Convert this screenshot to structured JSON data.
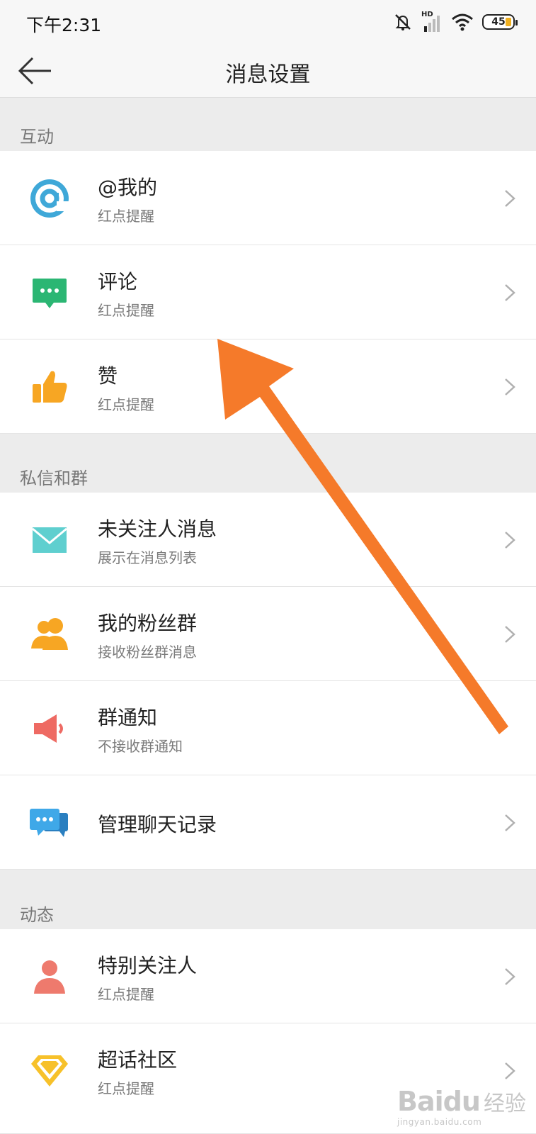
{
  "status_bar": {
    "time": "下午2:31",
    "battery_level": "45",
    "network_label": "HD"
  },
  "nav": {
    "title": "消息设置"
  },
  "sections": [
    {
      "header": "互动",
      "items": [
        {
          "title": "@我的",
          "subtitle": "红点提醒",
          "icon": "at-sign-icon",
          "has_chevron": true
        },
        {
          "title": "评论",
          "subtitle": "红点提醒",
          "icon": "comment-icon",
          "has_chevron": true
        },
        {
          "title": "赞",
          "subtitle": "红点提醒",
          "icon": "thumbs-up-icon",
          "has_chevron": true
        }
      ]
    },
    {
      "header": "私信和群",
      "items": [
        {
          "title": "未关注人消息",
          "subtitle": "展示在消息列表",
          "icon": "envelope-icon",
          "has_chevron": true
        },
        {
          "title": "我的粉丝群",
          "subtitle": "接收粉丝群消息",
          "icon": "fans-group-icon",
          "has_chevron": true
        },
        {
          "title": "群通知",
          "subtitle": "不接收群通知",
          "icon": "megaphone-icon",
          "has_chevron": true
        },
        {
          "title": "管理聊天记录",
          "subtitle": "",
          "icon": "chat-bubbles-icon",
          "has_chevron": true
        }
      ]
    },
    {
      "header": "动态",
      "items": [
        {
          "title": "特别关注人",
          "subtitle": "红点提醒",
          "icon": "person-icon",
          "has_chevron": true
        },
        {
          "title": "超话社区",
          "subtitle": "红点提醒",
          "icon": "diamond-icon",
          "has_chevron": true
        }
      ]
    }
  ],
  "watermark": {
    "logo": "Baidu",
    "cn": "经验",
    "url": "jingyan.baidu.com"
  },
  "colors": {
    "annotation_arrow": "#f57a2a",
    "at": "#3fa8d8",
    "comment": "#2bb673",
    "thumbs": "#f7a623",
    "envelope": "#5fcfcf",
    "fans": "#f7a623",
    "megaphone": "#ee6a63",
    "chat": "#3fa8e8",
    "person": "#ee7a6d",
    "diamond": "#f7c12a"
  }
}
